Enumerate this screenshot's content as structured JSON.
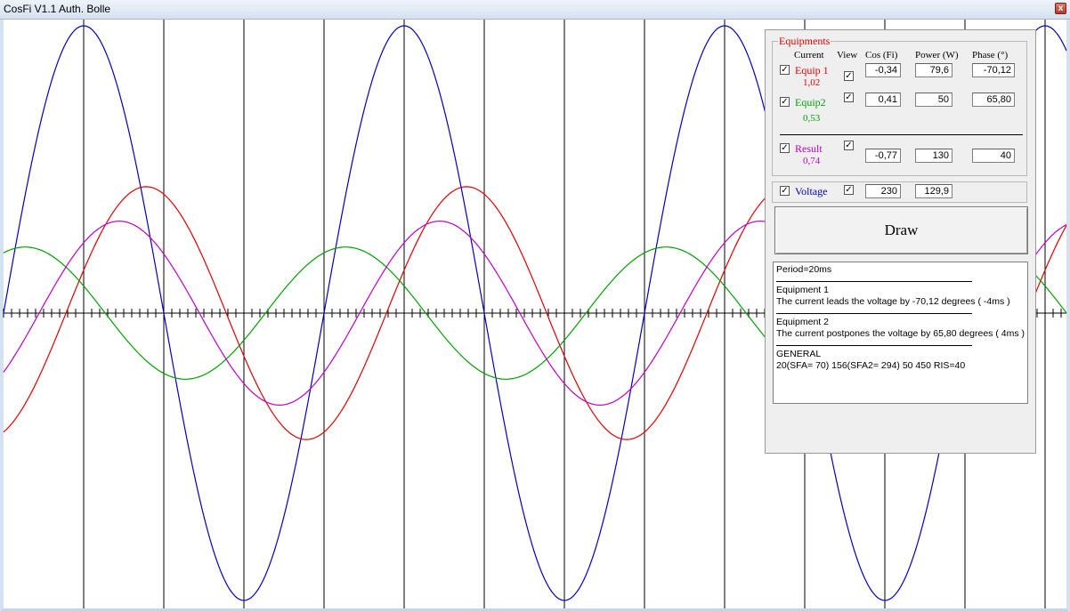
{
  "window": {
    "title": "CosFi V1.1 Auth. Bolle",
    "close_glyph": "x"
  },
  "colors": {
    "equip1": "#e00000",
    "equip2": "#00a000",
    "result": "#c000c0",
    "voltage": "#0000c0",
    "axis": "#000000"
  },
  "panel": {
    "group_title": "Equipments",
    "headers": {
      "current": "Current",
      "view": "View",
      "cos": "Cos (Fi)",
      "power": "Power (W)",
      "phase": "Phase (°)"
    },
    "rows": [
      {
        "name": "Equip 1",
        "current": "1,02",
        "cos": "-0,34",
        "power": "79,6",
        "phase": "-70,12",
        "checked": true,
        "view": true
      },
      {
        "name": "Equip2",
        "current": "0,53",
        "cos": "0,41",
        "power": "50",
        "phase": "65,80",
        "checked": true,
        "view": true
      },
      {
        "name": "Result",
        "current": "0,74",
        "cos": "-0,77",
        "power": "130",
        "phase": "40",
        "checked": true,
        "view": true
      }
    ],
    "voltage": {
      "name": "Voltage",
      "value": "230",
      "second": "129,9",
      "checked": true,
      "view": true
    },
    "check_glyph": "✓",
    "draw_label": "Draw",
    "memo": {
      "period": "Period=20ms",
      "eq1_title": "Equipment 1",
      "eq1_text": "The current leads the voltage by -70,12 degrees ( -4ms )",
      "eq2_title": "Equipment 2",
      "eq2_text": "The current postpones the voltage by 65,80 degrees ( 4ms )",
      "general_title": "GENERAL",
      "general_text": "20(SFA= 70) 156(SFA2= 294)  50 450 RIS=40"
    }
  },
  "chart_data": {
    "type": "line",
    "period_ms": 20,
    "x_range_periods": [
      0,
      3.3
    ],
    "grid": "vertical lines every quarter period",
    "series": [
      {
        "amplitude": 1.0,
        "phase_deg": 0,
        "color": "#0000c0"
      },
      {
        "amplitude": 0.44,
        "phase_deg": -70.12,
        "color": "#e00000"
      },
      {
        "amplitude": 0.23,
        "phase_deg": 65.8,
        "color": "#00a000"
      },
      {
        "amplitude": 0.32,
        "phase_deg": -40,
        "color": "#c000c0"
      }
    ]
  }
}
